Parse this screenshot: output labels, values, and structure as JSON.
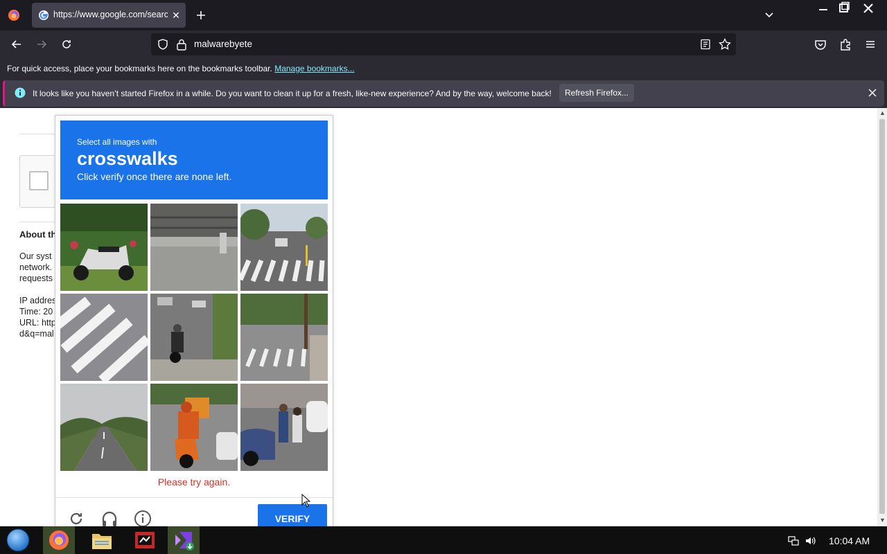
{
  "browser": {
    "tab_title": "https://www.google.com/search?q=malwarebyete",
    "url": "malwarebyete",
    "bookmarks_hint": "For quick access, place your bookmarks here on the bookmarks toolbar.",
    "bookmarks_link": "Manage bookmarks...",
    "notification_text": "It looks like you haven’t started Firefox in a while. Do you want to clean it up for a fresh, like-new experience? And by the way, welcome back!",
    "notification_button": "Refresh Firefox..."
  },
  "page": {
    "about_title": "About th",
    "lines": [
      "Our syst",
      "network.",
      "requests",
      "",
      "IP addres",
      "Time: 20",
      "URL: http",
      "d&q=mal"
    ]
  },
  "captcha": {
    "instruction": "Select all images with",
    "object": "crosswalks",
    "note": "Click verify once there are none left.",
    "error": "Please try again.",
    "verify_label": "VERIFY",
    "tiles": [
      {
        "subject": "scooter parked on grass"
      },
      {
        "subject": "guardrail on roadside"
      },
      {
        "subject": "street with crosswalk"
      },
      {
        "subject": "crosswalk stripes close-up"
      },
      {
        "subject": "motorcyclist on street"
      },
      {
        "subject": "crosswalk near tree"
      },
      {
        "subject": "highway road"
      },
      {
        "subject": "delivery motorcyclist"
      },
      {
        "subject": "people near parked cars"
      }
    ]
  },
  "taskbar": {
    "clock": "10:04 AM"
  },
  "colors": {
    "captcha_blue": "#1a73e8",
    "error_red": "#d93025",
    "tab_bg": "#1c1b22",
    "toolbar_bg": "#2b2a33"
  }
}
